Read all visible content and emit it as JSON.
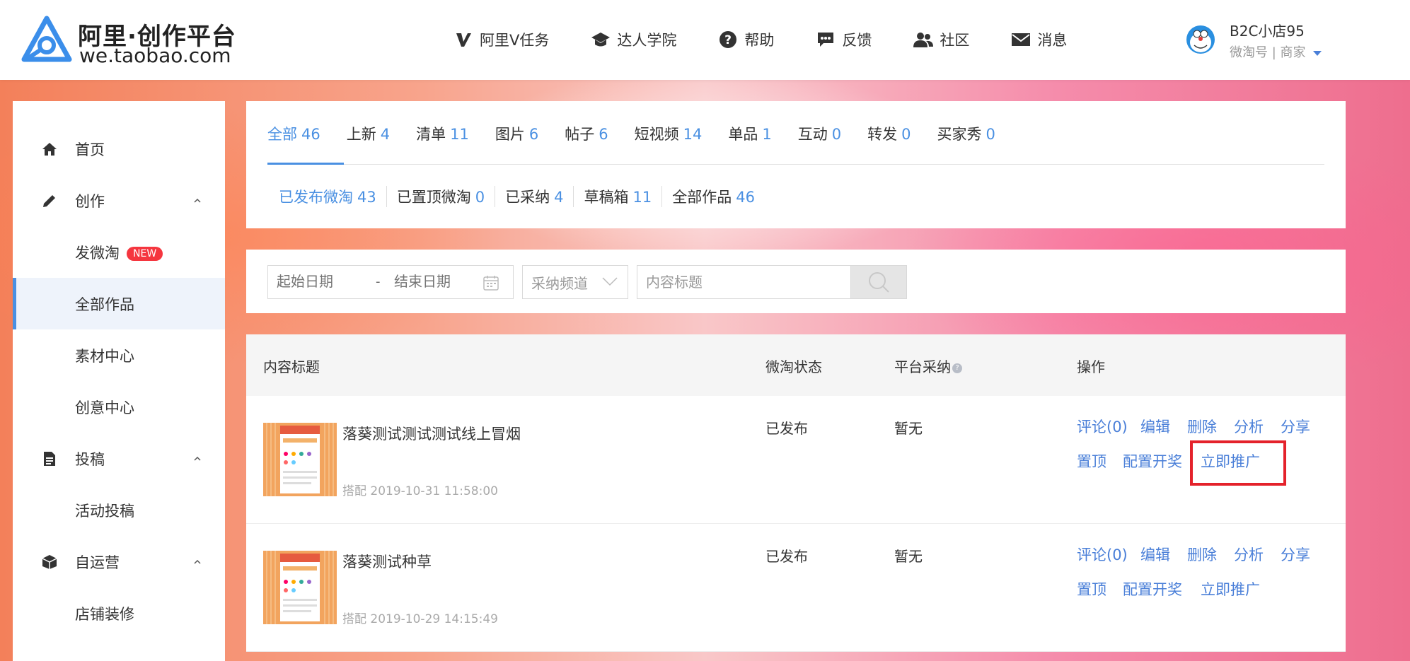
{
  "header": {
    "logo_title": "阿里·创作平台",
    "logo_sub": "we.taobao.com",
    "nav": [
      {
        "label": "阿里V任务",
        "icon": "v-icon"
      },
      {
        "label": "达人学院",
        "icon": "graduation-cap-icon"
      },
      {
        "label": "帮助",
        "icon": "help-icon"
      },
      {
        "label": "反馈",
        "icon": "chat-bubble-icon"
      },
      {
        "label": "社区",
        "icon": "users-icon"
      },
      {
        "label": "消息",
        "icon": "envelope-icon"
      }
    ],
    "user": {
      "name": "B2C小店95",
      "role": "微淘号 | 商家"
    }
  },
  "sidebar": {
    "items": [
      {
        "label": "首页",
        "icon": "home-icon"
      },
      {
        "label": "创作",
        "icon": "pencil-icon"
      },
      {
        "label": "发微淘",
        "badge": "NEW"
      },
      {
        "label": "全部作品"
      },
      {
        "label": "素材中心"
      },
      {
        "label": "创意中心"
      },
      {
        "label": "投稿",
        "icon": "document-icon"
      },
      {
        "label": "活动投稿"
      },
      {
        "label": "自运营",
        "icon": "box-icon"
      },
      {
        "label": "店铺装修"
      }
    ]
  },
  "tabs": [
    {
      "label": "全部",
      "count": "46"
    },
    {
      "label": "上新",
      "count": "4"
    },
    {
      "label": "清单",
      "count": "11"
    },
    {
      "label": "图片",
      "count": "6"
    },
    {
      "label": "帖子",
      "count": "6"
    },
    {
      "label": "短视频",
      "count": "14"
    },
    {
      "label": "单品",
      "count": "1"
    },
    {
      "label": "互动",
      "count": "0"
    },
    {
      "label": "转发",
      "count": "0"
    },
    {
      "label": "买家秀",
      "count": "0"
    }
  ],
  "subtabs": [
    {
      "label": "已发布微淘",
      "count": "43"
    },
    {
      "label": "已置顶微淘",
      "count": "0"
    },
    {
      "label": "已采纳",
      "count": "4"
    },
    {
      "label": "草稿箱",
      "count": "11"
    },
    {
      "label": "全部作品",
      "count": "46"
    }
  ],
  "filter": {
    "start_placeholder": "起始日期",
    "separator": "-",
    "end_placeholder": "结束日期",
    "channel_value": "采纳频道",
    "title_placeholder": "内容标题"
  },
  "table": {
    "headers": {
      "title": "内容标题",
      "status": "微淘状态",
      "adopt": "平台采纳",
      "ops": "操作"
    },
    "rows": [
      {
        "title": "落葵测试测试测试线上冒烟",
        "meta": "搭配 2019-10-31 11:58:00",
        "status": "已发布",
        "adopt": "暂无",
        "ops": [
          "评论(0)",
          "编辑",
          "删除",
          "分析",
          "分享",
          "置顶",
          "配置开奖",
          "立即推广"
        ]
      },
      {
        "title": "落葵测试种草",
        "meta": "搭配 2019-10-29 14:15:49",
        "status": "已发布",
        "adopt": "暂无",
        "ops": [
          "评论(0)",
          "编辑",
          "删除",
          "分析",
          "分享",
          "置顶",
          "配置开奖",
          "立即推广"
        ]
      }
    ]
  },
  "colors": {
    "accent": "#4a90e2",
    "link": "#4a7fd8",
    "highlight": "#e4222b",
    "badge": "#f5363f"
  }
}
